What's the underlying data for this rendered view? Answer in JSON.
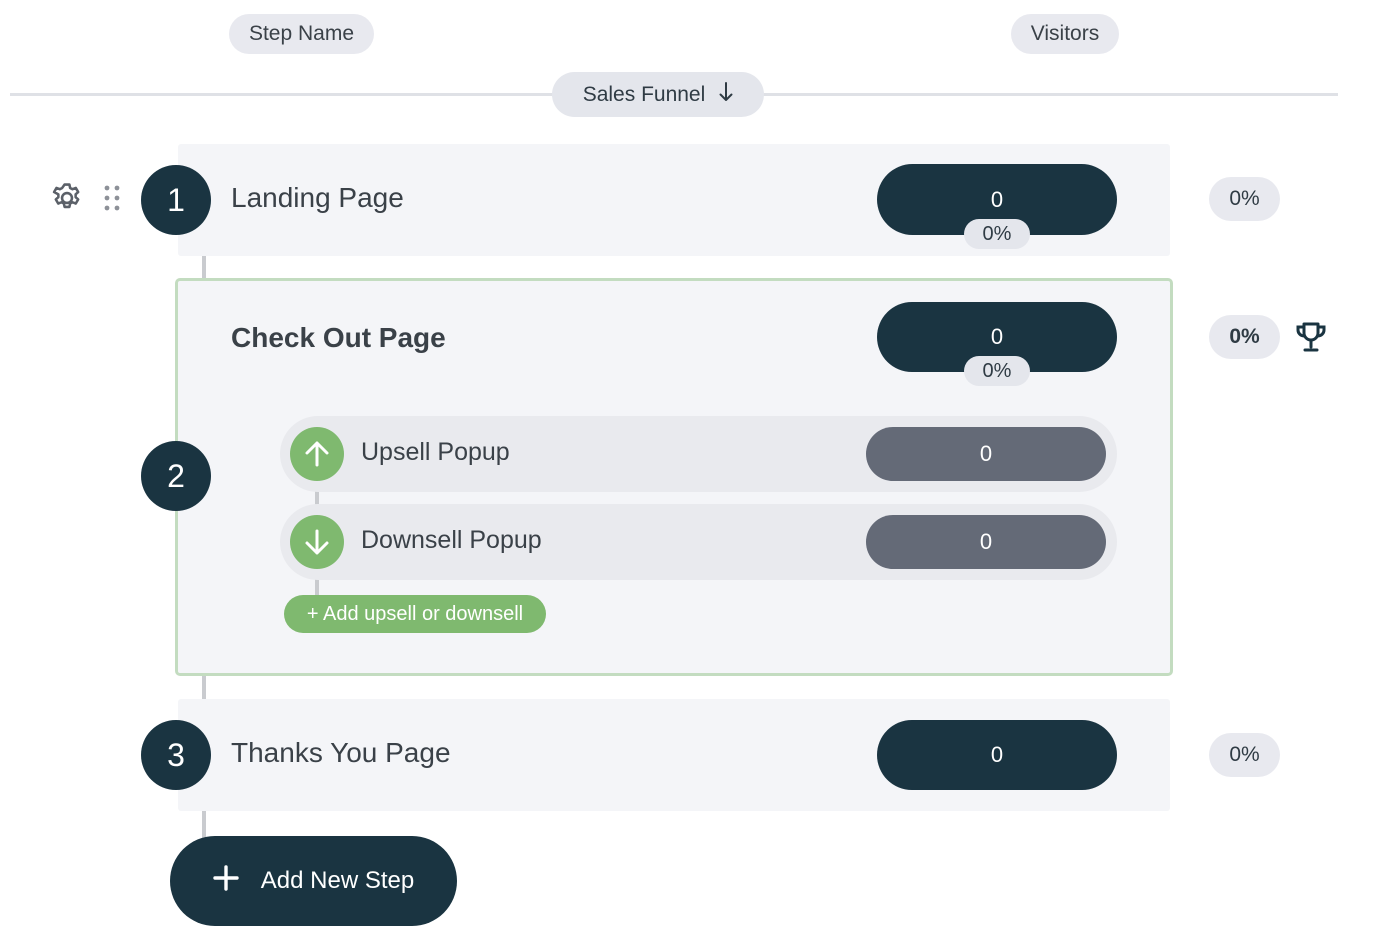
{
  "header": {
    "step_name": "Step Name",
    "visitors": "Visitors",
    "funnel_label": "Sales Funnel",
    "funnel_sort_icon": "arrow-down-icon"
  },
  "steps": [
    {
      "number": "1",
      "title": "Landing Page",
      "visitors": "0",
      "visitors_pct": "0%",
      "conversion": "0%"
    },
    {
      "number": "2",
      "title": "Check Out Page",
      "visitors": "0",
      "visitors_pct": "0%",
      "conversion": "0%",
      "goal_icon": "trophy-icon",
      "offers": [
        {
          "type": "upsell",
          "icon": "arrow-up-icon",
          "label": "Upsell Popup",
          "visitors": "0"
        },
        {
          "type": "downsell",
          "icon": "arrow-down-icon",
          "label": "Downsell Popup",
          "visitors": "0"
        }
      ],
      "add_offer_label": "+ Add upsell or downsell"
    },
    {
      "number": "3",
      "title": "Thanks You Page",
      "visitors": "0",
      "conversion": "0%"
    }
  ],
  "add_step_label": "Add New Step",
  "toolbar_icons": [
    "gear-icon",
    "drag-handle-icon"
  ],
  "colors": {
    "dark": "#1a3441",
    "accent_green": "#7fb96f",
    "checkout_border": "#c3dcc0",
    "row_bg": "#f4f5f8",
    "offer_count_bg": "#646a77"
  }
}
